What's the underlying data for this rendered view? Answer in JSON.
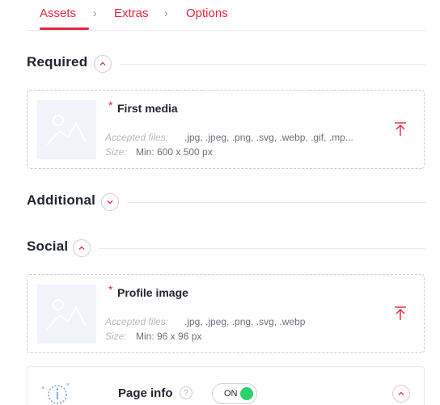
{
  "stepper": {
    "steps": [
      {
        "label": "Assets",
        "active": true
      },
      {
        "label": "Extras",
        "active": false
      },
      {
        "label": "Options",
        "active": false
      }
    ],
    "accent_color": "#e8253d"
  },
  "sections": {
    "required": {
      "title": "Required",
      "expanded": true
    },
    "additional": {
      "title": "Additional",
      "expanded": false
    },
    "social": {
      "title": "Social",
      "expanded": true
    }
  },
  "media": {
    "first": {
      "required_mark": "*",
      "title": "First media",
      "accepted_label": "Accepted files:",
      "accepted_value": ".jpg, .jpeg, .png, .svg, .webp, .gif, .mp...",
      "size_label": "Size:",
      "size_value": "Min: 600 x 500 px"
    },
    "profile": {
      "required_mark": "*",
      "title": "Profile image",
      "accepted_label": "Accepted files:",
      "accepted_value": ".jpg, .jpeg, .png, .svg, .webp",
      "size_label": "Size:",
      "size_value": "Min: 96 x 96 px"
    }
  },
  "page_info": {
    "title": "Page info",
    "help_glyph": "?",
    "switch_label": "ON",
    "switch_on": true,
    "switch_color": "#2bd16a"
  },
  "icons": {
    "step_separator": "chevron-right-icon",
    "collapse": "chevron-up-icon",
    "expand": "chevron-down-icon",
    "placeholder": "image-placeholder-icon",
    "upload": "upload-icon",
    "info": "info-icon"
  }
}
